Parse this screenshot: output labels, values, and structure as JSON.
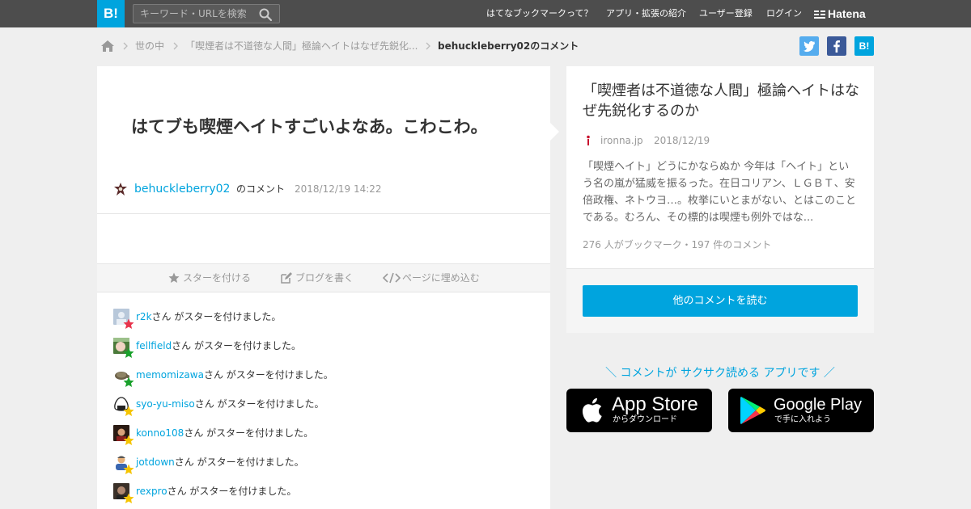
{
  "header": {
    "logo": "B!",
    "search_placeholder": "キーワード・URLを検索",
    "nav": [
      "はてなブックマークって？",
      "アプリ・拡張の紹介",
      "ユーザー登録",
      "ログイン"
    ],
    "brand": "Hatena"
  },
  "breadcrumb": {
    "items": [
      "世の中",
      "「喫煙者は不道徳な人間」極論ヘイトはなぜ先鋭化..."
    ],
    "current": "behuckleberry02のコメント"
  },
  "share": {
    "twitter_color": "#55acee",
    "facebook_color": "#3b5998",
    "hatena_color": "#00a4de",
    "hatena_label": "B!"
  },
  "comment": {
    "text": "はてブも喫煙ヘイトすごいよなあ。こわこわ。",
    "user": "behuckleberry02",
    "user_suffix": "のコメント",
    "date": "2018/12/19 14:22"
  },
  "actions": {
    "star": "スターを付ける",
    "blog": "ブログを書く",
    "embed": "ページに埋め込む"
  },
  "stars": {
    "suffix": "さん がスターを付けました。",
    "items": [
      {
        "user": "r2k",
        "star_color": "#e8344c"
      },
      {
        "user": "fellfield",
        "star_color": "#1aa12c"
      },
      {
        "user": "memomizawa",
        "star_color": "#1aa12c"
      },
      {
        "user": "syo-yu-miso",
        "star_color": "#f5c400"
      },
      {
        "user": "konno108",
        "star_color": "#f5c400"
      },
      {
        "user": "jotdown",
        "star_color": "#f5c400"
      },
      {
        "user": "rexpro",
        "star_color": "#f5c400"
      }
    ]
  },
  "entry": {
    "title": "「喫煙者は不道徳な人間」極論ヘイトはなぜ先鋭化するのか",
    "domain": "ironna.jp",
    "date": "2018/12/19",
    "description": "「喫煙ヘイト」どうにかならぬか 今年は「ヘイト」という名の嵐が猛威を振るった。在日コリアン、ＬＧＢＴ、安倍政権、ネトウヨ…。枚挙にいとまがない、とはこのことである。むろん、その標的は喫煙も例外ではな...",
    "counts": "276 人がブックマーク・197 件のコメント",
    "read_more": "他のコメントを読む"
  },
  "app": {
    "promo": "＼ コメントが サクサク読める アプリです ／",
    "appstore_name": "App Store",
    "appstore_sub": "からダウンロード",
    "googleplay_name": "Google Play",
    "googleplay_sub": "で手に入れよう"
  },
  "colors": {
    "accent": "#00a4de",
    "topbar": "#4d4d4d",
    "background": "#efefef"
  }
}
